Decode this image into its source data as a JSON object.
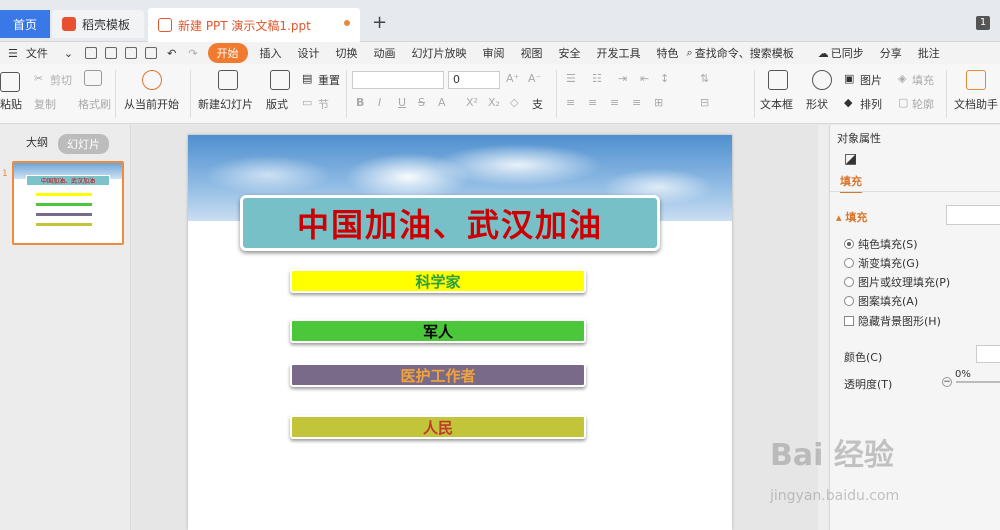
{
  "tabs": {
    "home": "首页",
    "templates": "稻壳模板",
    "document": "新建 PPT 演示文稿1.ppt",
    "badge": "1"
  },
  "menu": {
    "file": "文件",
    "items": [
      "开始",
      "插入",
      "设计",
      "切换",
      "动画",
      "幻灯片放映",
      "审阅",
      "视图",
      "安全",
      "开发工具",
      "特色"
    ],
    "search": "查找命令、搜索模板",
    "sync": "已同步",
    "share": "分享",
    "comment": "批注"
  },
  "ribbon": {
    "paste": "粘贴",
    "cut": "剪切",
    "copy": "复制",
    "format_painter": "格式刷",
    "from_current": "从当前开始",
    "new_slide": "新建幻灯片",
    "layout": "版式",
    "reset": "重置",
    "section": "节",
    "font_size": "0",
    "textbox": "文本框",
    "shape": "形状",
    "picture": "图片",
    "fill": "填充",
    "arrange": "排列",
    "outline": "轮廓",
    "doc_helper": "文档助手"
  },
  "left_panel": {
    "tab_outline": "大纲",
    "tab_slides": "幻灯片",
    "slide_number": "1"
  },
  "slide": {
    "title": "中国加油、武汉加油",
    "bars": [
      {
        "label": "科学家",
        "bg": "#ffff00",
        "color": "#2e9e3c"
      },
      {
        "label": "军人",
        "bg": "#4cc63a",
        "color": "#000000"
      },
      {
        "label": "医护工作者",
        "bg": "#7a6a8a",
        "color": "#f2a33a"
      },
      {
        "label": "人民",
        "bg": "#c2c43a",
        "color": "#c0392b"
      }
    ]
  },
  "right_panel": {
    "header": "对象属性",
    "tab_fill": "填充",
    "section_fill": "填充",
    "options": [
      "纯色填充(S)",
      "渐变填充(G)",
      "图片或纹理填充(P)",
      "图案填充(A)"
    ],
    "hide_bg": "隐藏背景图形(H)",
    "color_label": "颜色(C)",
    "transparency_label": "透明度(T)",
    "transparency_value": "0%"
  },
  "watermark": {
    "main": "Bai 经验",
    "sub": "jingyan.baidu.com"
  }
}
